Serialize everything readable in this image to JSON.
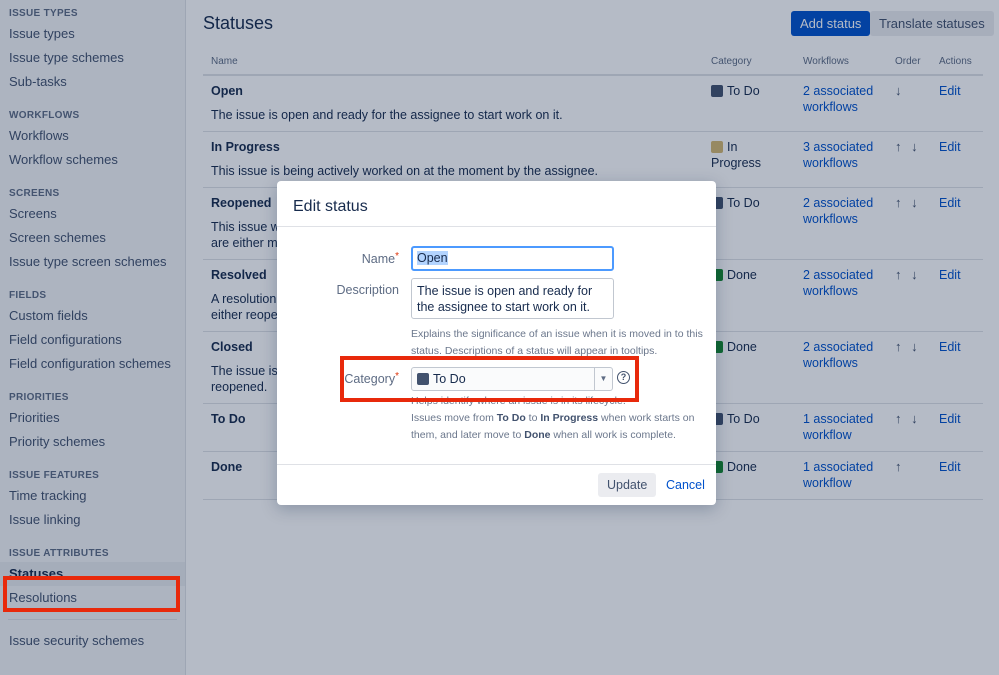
{
  "sidebar": {
    "sections": [
      {
        "heading": "ISSUE TYPES",
        "items": [
          "Issue types",
          "Issue type schemes",
          "Sub-tasks"
        ]
      },
      {
        "heading": "WORKFLOWS",
        "items": [
          "Workflows",
          "Workflow schemes"
        ]
      },
      {
        "heading": "SCREENS",
        "items": [
          "Screens",
          "Screen schemes",
          "Issue type screen schemes"
        ]
      },
      {
        "heading": "FIELDS",
        "items": [
          "Custom fields",
          "Field configurations",
          "Field configuration schemes"
        ]
      },
      {
        "heading": "PRIORITIES",
        "items": [
          "Priorities",
          "Priority schemes"
        ]
      },
      {
        "heading": "ISSUE FEATURES",
        "items": [
          "Time tracking",
          "Issue linking"
        ]
      },
      {
        "heading": "ISSUE ATTRIBUTES",
        "items": [
          "Statuses",
          "Resolutions"
        ]
      }
    ],
    "footer_item": "Issue security schemes"
  },
  "main": {
    "title": "Statuses",
    "add_button": "Add status",
    "translate_button": "Translate statuses",
    "columns": [
      "Name",
      "Category",
      "Workflows",
      "Order",
      "Actions"
    ],
    "rows": [
      {
        "name": "Open",
        "desc": "The issue is open and ready for the assignee to start work on it.",
        "category": "To Do",
        "wf1": "2 associated",
        "wf2": "workflows",
        "order": "↓",
        "action": "Edit"
      },
      {
        "name": "In Progress",
        "desc": "This issue is being actively worked on at the moment by the assignee.",
        "category": "In Progress",
        "wf1": "3 associated",
        "wf2": "workflows",
        "order": "↑ ↓",
        "action": "Edit"
      },
      {
        "name": "Reopened",
        "desc": "This issue wa",
        "desc2": "are either ma",
        "category": "To Do",
        "wf1": "2 associated",
        "wf2": "workflows",
        "order": "↑ ↓",
        "action": "Edit"
      },
      {
        "name": "Resolved",
        "desc": "A resolution",
        "desc2": "either reope",
        "category": "Done",
        "wf1": "2 associated",
        "wf2": "workflows",
        "order": "↑ ↓",
        "action": "Edit"
      },
      {
        "name": "Closed",
        "desc": "The issue is c",
        "desc2": "reopened.",
        "category": "Done",
        "wf1": "2 associated",
        "wf2": "workflows",
        "order": "↑ ↓",
        "action": "Edit"
      },
      {
        "name": "To Do",
        "desc": "",
        "category": "To Do",
        "wf1": "1 associated",
        "wf2": "workflow",
        "order": "↑ ↓",
        "action": "Edit"
      },
      {
        "name": "Done",
        "desc": "",
        "category": "Done",
        "wf1": "1 associated",
        "wf2": "workflow",
        "order": "↑",
        "action": "Edit"
      }
    ]
  },
  "colors": {
    "todo": "#42526e",
    "inprogress": "#d5b870",
    "done": "#14892c",
    "primary": "#0052cc",
    "highlight": "#e8290b"
  },
  "dialog": {
    "title": "Edit status",
    "name_label": "Name",
    "name_value": "Open",
    "description_label": "Description",
    "description_value": "The issue is open and ready for the assignee to start work on it.",
    "description_help_1": "Explains the significance of an issue when it is moved in to this",
    "description_help_2": "status. Descriptions of a status will appear in tooltips.",
    "category_label": "Category",
    "category_value": "To Do",
    "category_help_1": "Helps identify where an issue is in its lifecycle.",
    "category_help_2a": "Issues move from ",
    "category_help_2b": "To Do",
    "category_help_2c": " to ",
    "category_help_2d": "In Progress",
    "category_help_2e": " when work starts on",
    "category_help_3a": "them, and later move to ",
    "category_help_3b": "Done",
    "category_help_3c": " when all work is complete.",
    "update_button": "Update",
    "cancel_button": "Cancel"
  }
}
